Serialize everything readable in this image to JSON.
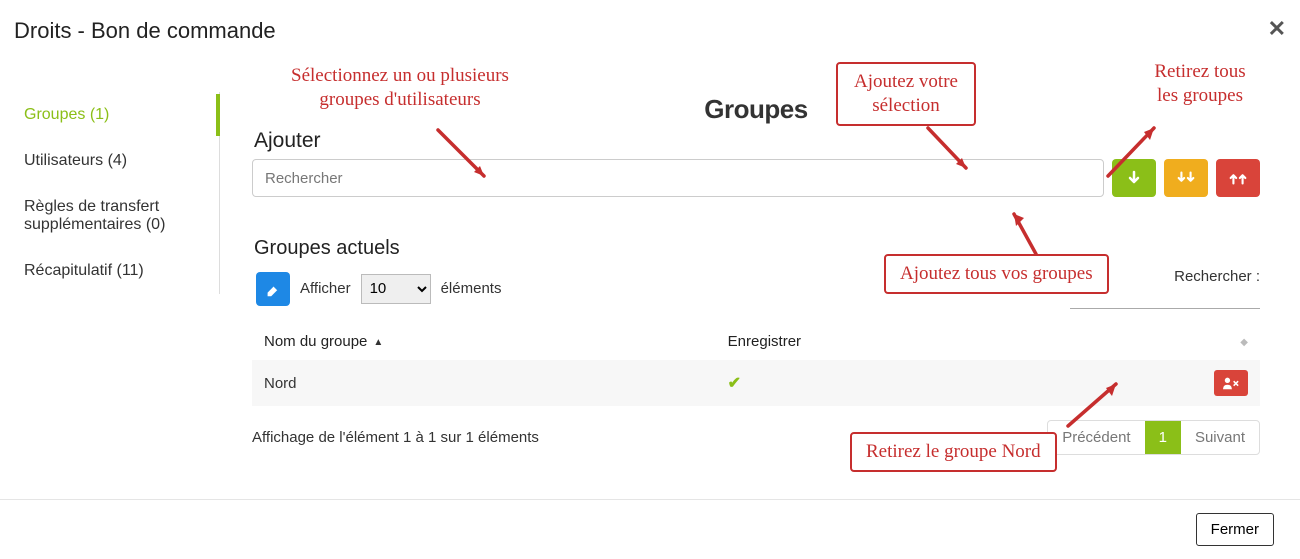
{
  "header": {
    "title": "Droits - Bon de commande"
  },
  "sidebar": {
    "items": [
      {
        "label": "Groupes (1)",
        "active": true
      },
      {
        "label": "Utilisateurs (4)"
      },
      {
        "label": "Règles de transfert supplémentaires (0)"
      },
      {
        "label": "Récapitulatif (11)"
      }
    ]
  },
  "main": {
    "title": "Groupes",
    "add_label": "Ajouter",
    "search_placeholder": "Rechercher",
    "section2": "Groupes actuels"
  },
  "table": {
    "length_prefix": "Afficher",
    "length_suffix": "éléments",
    "length_value": "10",
    "search_label": "Rechercher :",
    "col_name": "Nom du groupe",
    "col_save": "Enregistrer",
    "rows": [
      {
        "name": "Nord",
        "saved": "✔"
      }
    ],
    "info": "Affichage de l'élément 1 à 1 sur 1 éléments",
    "prev": "Précédent",
    "page": "1",
    "next": "Suivant"
  },
  "footer": {
    "close": "Fermer"
  },
  "annotations": {
    "select_groups": "Sélectionnez un ou plusieurs\ngroupes d'utilisateurs",
    "add_selection": "Ajoutez votre\nsélection",
    "remove_all": "Retirez tous\nles groupes",
    "add_all": "Ajoutez tous vos groupes",
    "remove_nord": "Retirez le groupe Nord"
  }
}
